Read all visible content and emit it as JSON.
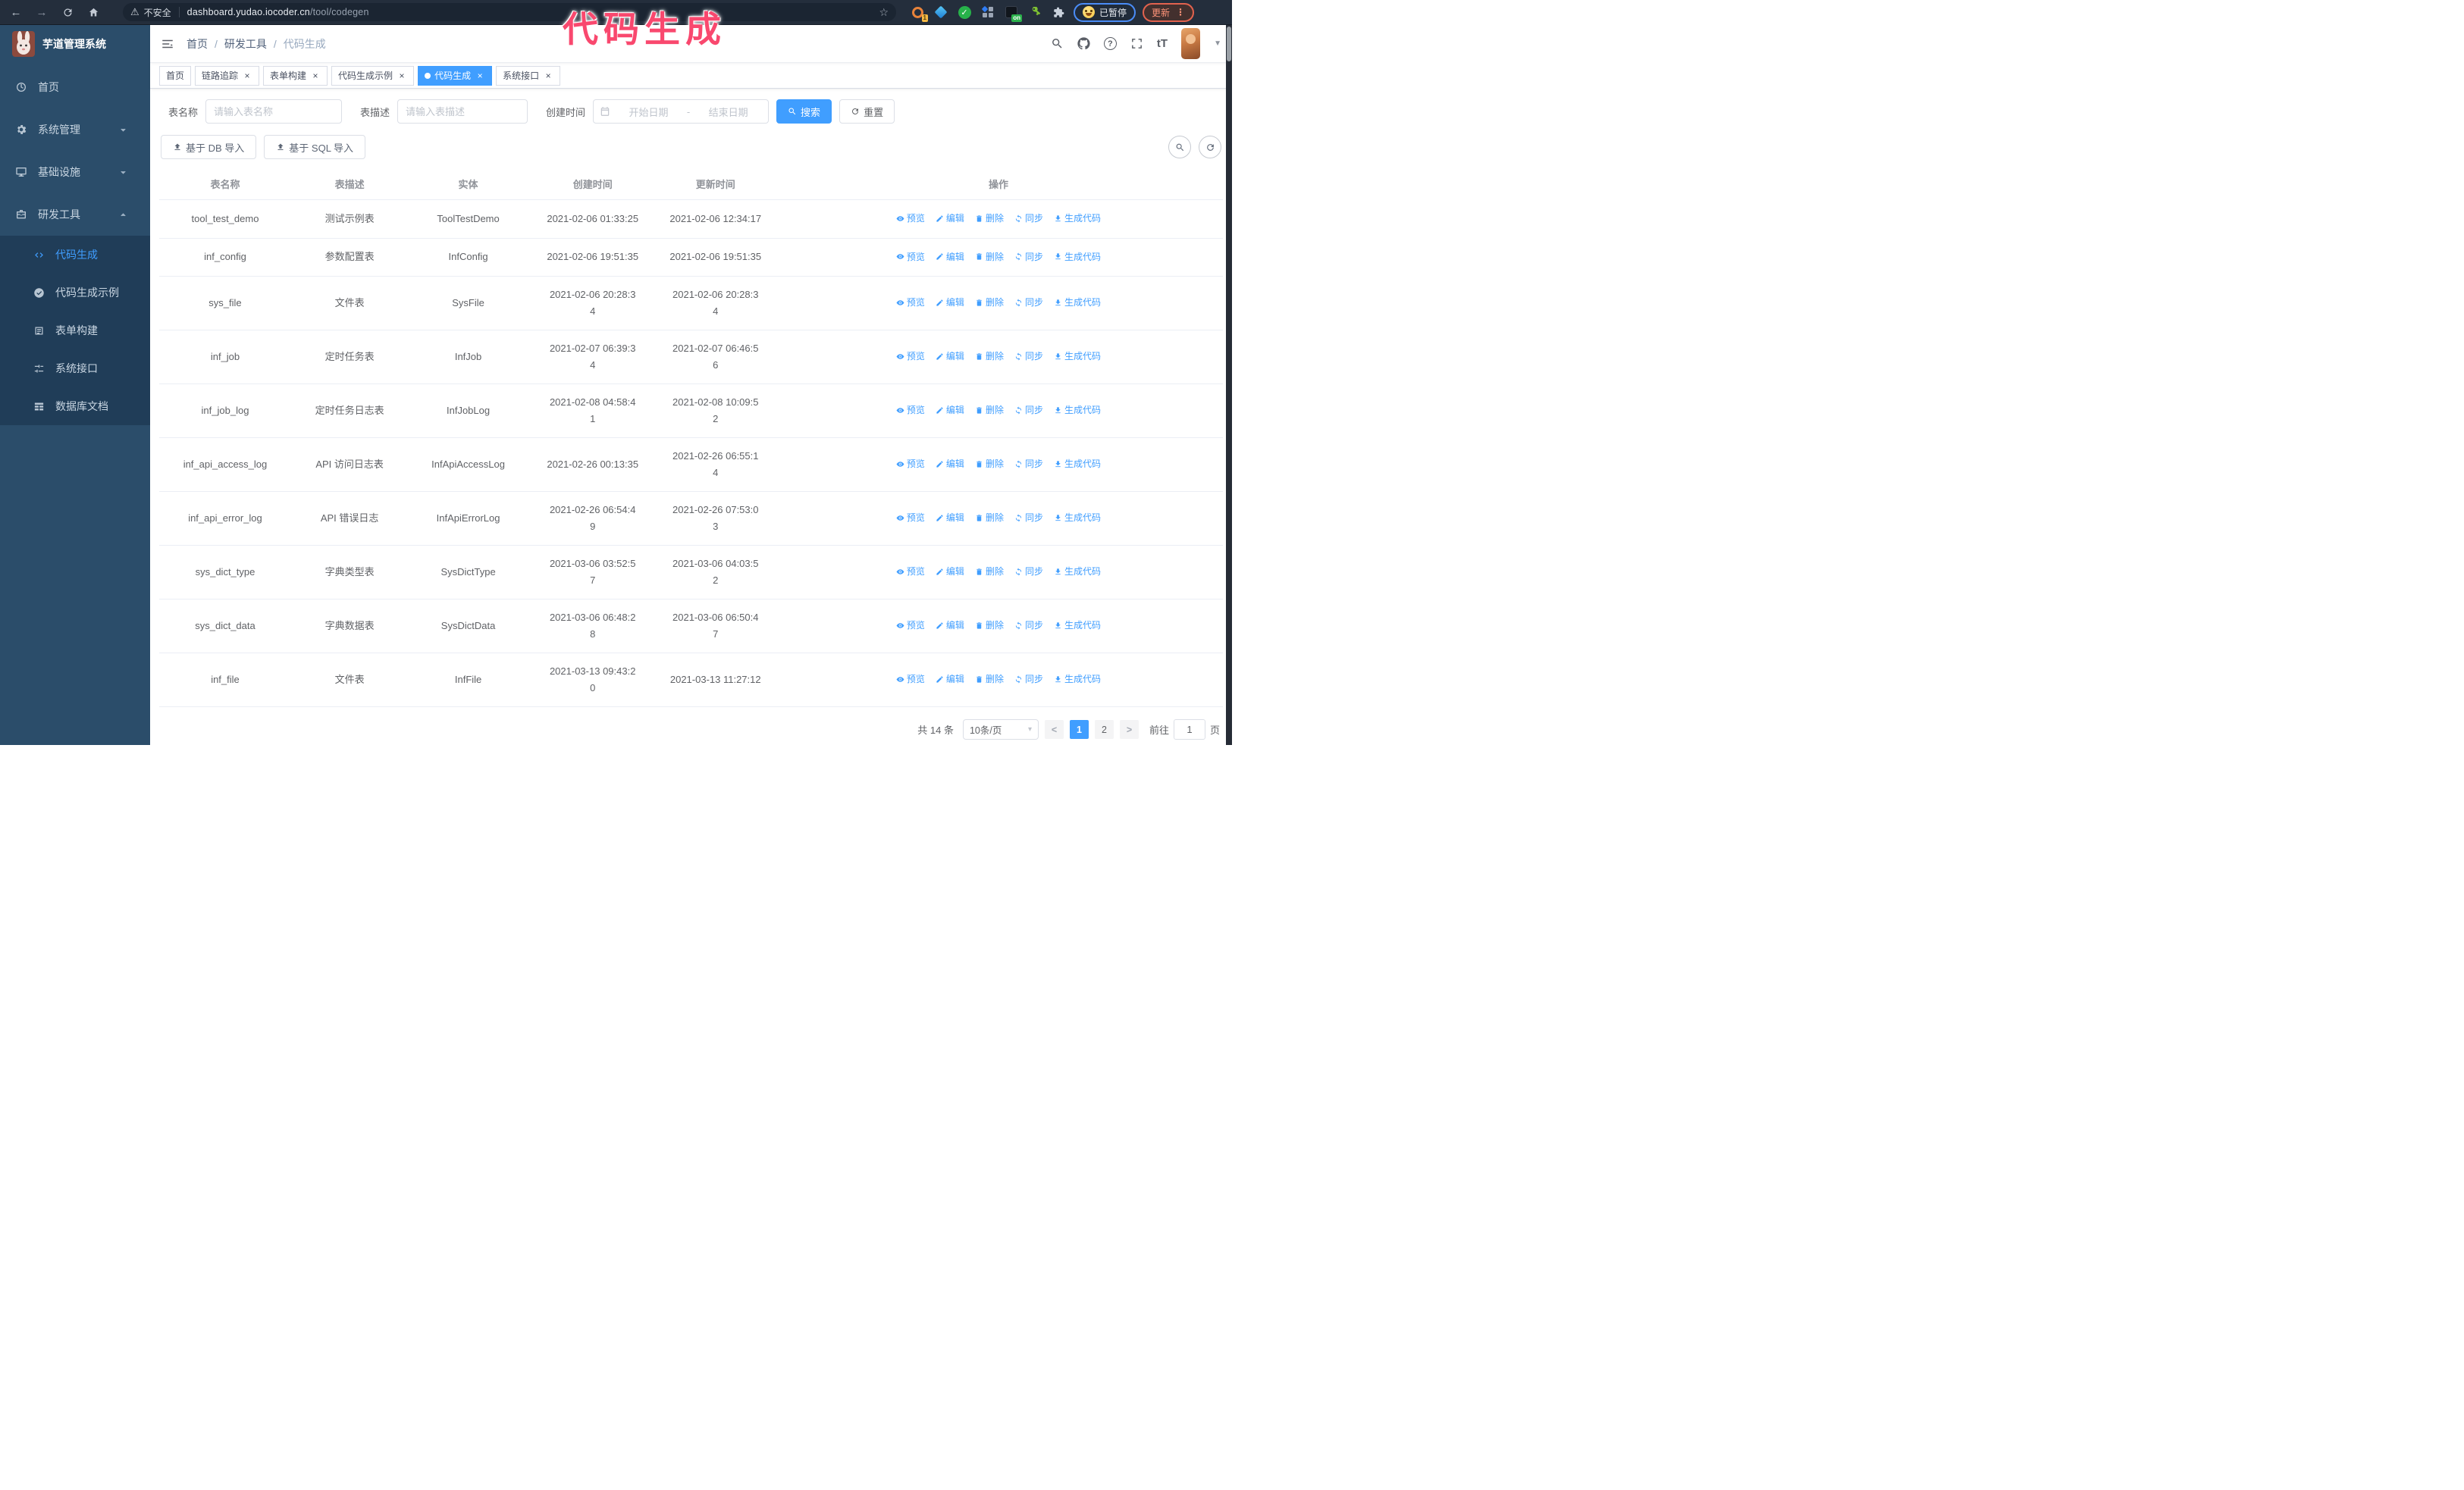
{
  "browser": {
    "security_warning": "不安全",
    "url_domain": "dashboard.yudao.iocoder.cn",
    "url_path": "/tool/codegen",
    "extension_badge": "1",
    "extension_on_badge": "on",
    "profile_chip": "已暂停",
    "update_button": "更新"
  },
  "annotation": {
    "text": "代码生成"
  },
  "sidebar": {
    "title": "芋道管理系统",
    "items": [
      {
        "label": "首页"
      },
      {
        "label": "系统管理"
      },
      {
        "label": "基础设施"
      },
      {
        "label": "研发工具"
      }
    ],
    "submenu": [
      {
        "label": "代码生成"
      },
      {
        "label": "代码生成示例"
      },
      {
        "label": "表单构建"
      },
      {
        "label": "系统接口"
      },
      {
        "label": "数据库文档"
      }
    ]
  },
  "navbar": {
    "breadcrumb": [
      "首页",
      "研发工具",
      "代码生成"
    ]
  },
  "tags": [
    {
      "label": "首页"
    },
    {
      "label": "链路追踪"
    },
    {
      "label": "表单构建"
    },
    {
      "label": "代码生成示例"
    },
    {
      "label": "代码生成"
    },
    {
      "label": "系统接口"
    }
  ],
  "search": {
    "name_label": "表名称",
    "name_placeholder": "请输入表名称",
    "desc_label": "表描述",
    "desc_placeholder": "请输入表描述",
    "time_label": "创建时间",
    "start_placeholder": "开始日期",
    "range_separator": "-",
    "end_placeholder": "结束日期",
    "search_button": "搜索",
    "reset_button": "重置"
  },
  "toolbar": {
    "import_db": "基于 DB 导入",
    "import_sql": "基于 SQL 导入"
  },
  "table": {
    "columns": [
      "表名称",
      "表描述",
      "实体",
      "创建时间",
      "更新时间",
      "操作"
    ],
    "actions": [
      {
        "label": "预览",
        "icon": "eye-icon",
        "name": "preview-button"
      },
      {
        "label": "编辑",
        "icon": "edit-icon",
        "name": "edit-button"
      },
      {
        "label": "删除",
        "icon": "delete-icon",
        "name": "delete-button"
      },
      {
        "label": "同步",
        "icon": "sync-icon",
        "name": "sync-button"
      },
      {
        "label": "生成代码",
        "icon": "download-icon",
        "name": "generate-code-button"
      }
    ],
    "rows": [
      {
        "name": "tool_test_demo",
        "desc": "测试示例表",
        "entity": "ToolTestDemo",
        "create_time": "2021-02-06 01:33:25",
        "update_time": "2021-02-06 12:34:17"
      },
      {
        "name": "inf_config",
        "desc": "参数配置表",
        "entity": "InfConfig",
        "create_time": "2021-02-06 19:51:35",
        "update_time": "2021-02-06 19:51:35"
      },
      {
        "name": "sys_file",
        "desc": "文件表",
        "entity": "SysFile",
        "create_time": "2021-02-06 20:28:3\n4",
        "update_time": "2021-02-06 20:28:3\n4"
      },
      {
        "name": "inf_job",
        "desc": "定时任务表",
        "entity": "InfJob",
        "create_time": "2021-02-07 06:39:3\n4",
        "update_time": "2021-02-07 06:46:5\n6"
      },
      {
        "name": "inf_job_log",
        "desc": "定时任务日志表",
        "entity": "InfJobLog",
        "create_time": "2021-02-08 04:58:4\n1",
        "update_time": "2021-02-08 10:09:5\n2"
      },
      {
        "name": "inf_api_access_log",
        "desc": "API 访问日志表",
        "entity": "InfApiAccessLog",
        "create_time": "2021-02-26 00:13:35",
        "update_time": "2021-02-26 06:55:1\n4"
      },
      {
        "name": "inf_api_error_log",
        "desc": "API 错误日志",
        "entity": "InfApiErrorLog",
        "create_time": "2021-02-26 06:54:4\n9",
        "update_time": "2021-02-26 07:53:0\n3"
      },
      {
        "name": "sys_dict_type",
        "desc": "字典类型表",
        "entity": "SysDictType",
        "create_time": "2021-03-06 03:52:5\n7",
        "update_time": "2021-03-06 04:03:5\n2"
      },
      {
        "name": "sys_dict_data",
        "desc": "字典数据表",
        "entity": "SysDictData",
        "create_time": "2021-03-06 06:48:2\n8",
        "update_time": "2021-03-06 06:50:4\n7"
      },
      {
        "name": "inf_file",
        "desc": "文件表",
        "entity": "InfFile",
        "create_time": "2021-03-13 09:43:2\n0",
        "update_time": "2021-03-13 11:27:12"
      }
    ]
  },
  "pagination": {
    "total": "共 14 条",
    "page_size": "10条/页",
    "pages": [
      "1",
      "2"
    ],
    "active_page": "1",
    "goto_label": "前往",
    "goto_value": "1",
    "goto_suffix": "页"
  },
  "colors": {
    "primary": "#409eff",
    "annotation": "#f9486e",
    "sidebar_bg": "#2b4d6a",
    "submenu_bg": "#203d58"
  }
}
